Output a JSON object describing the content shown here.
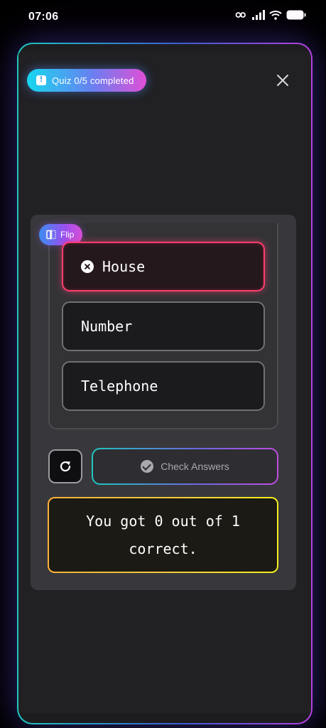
{
  "status_bar": {
    "time": "07:06",
    "icons": [
      "key-icon",
      "signal-icon",
      "wifi-icon",
      "battery-icon"
    ]
  },
  "header": {
    "quiz_progress": "Quiz 0/5 completed",
    "close_icon": "close-icon"
  },
  "card": {
    "flip_label": "Flip",
    "options": [
      {
        "label": "House",
        "state": "incorrect-selected"
      },
      {
        "label": "Number",
        "state": "default"
      },
      {
        "label": "Telephone",
        "state": "default"
      }
    ],
    "reset_icon": "refresh-icon",
    "check_answers_label": "Check Answers",
    "result_text": "You got 0 out of 1 correct."
  },
  "colors": {
    "accent_cyan": "#17d7ef",
    "accent_purple": "#e14fd6",
    "wrong_border": "#ff3d6e",
    "result_border": "#ffb13a",
    "background": "#212124"
  }
}
